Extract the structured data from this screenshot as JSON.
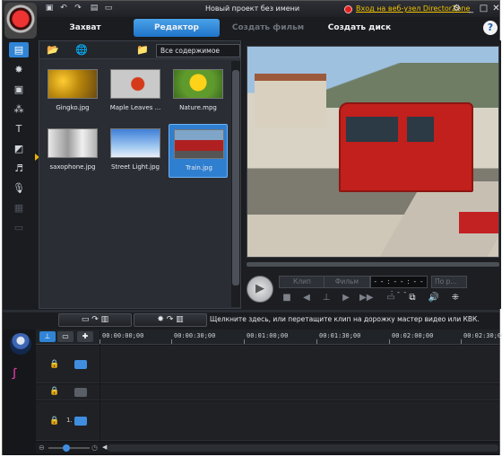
{
  "titlebar": {
    "title": "Новый проект без имени",
    "directorzone_link": "Вход на веб-узел DirectorZone",
    "quick_access": [
      "save-icon",
      "undo-icon",
      "redo-icon",
      "new-icon",
      "open-icon"
    ],
    "window_controls": [
      "settings-icon",
      "minimize-icon",
      "maximize-icon",
      "close-icon"
    ]
  },
  "tabs": [
    {
      "label": "Захват",
      "state": "normal"
    },
    {
      "label": "Редактор",
      "state": "active"
    },
    {
      "label": "Создать фильм",
      "state": "disabled"
    },
    {
      "label": "Создать диск",
      "state": "normal"
    }
  ],
  "help_label": "?",
  "sidebar": {
    "items": [
      "media-room-icon",
      "fx-room-icon",
      "pip-objects-icon",
      "particle-room-icon",
      "title-room-icon",
      "transition-room-icon",
      "audio-mixing-icon",
      "voice-over-icon",
      "chapter-room-icon",
      "subtitle-room-icon"
    ]
  },
  "library": {
    "filter_value": "Все содержимое",
    "items": [
      {
        "caption": "Gingko.jpg",
        "type": "ginkgo",
        "selected": false
      },
      {
        "caption": "Maple Leaves ...",
        "type": "maple",
        "selected": false
      },
      {
        "caption": "Nature.mpg",
        "type": "nature",
        "selected": false
      },
      {
        "caption": "saxophone.jpg",
        "type": "sax",
        "selected": false
      },
      {
        "caption": "Street Light.jpg",
        "type": "light",
        "selected": false
      },
      {
        "caption": "Train.jpg",
        "type": "train",
        "selected": true
      }
    ]
  },
  "preview": {
    "clip_label": "Клип",
    "movie_label": "Фильм",
    "timecode": "- - : - - : - - : - -",
    "quality": "По р..."
  },
  "timeline_toolbar": {
    "hint": "Щелкните здесь, или перетащите клип на дорожку мастер видео или КВК."
  },
  "ruler": {
    "ticks": [
      "00:00:00;00",
      "00:00:30;00",
      "00:01:00;00",
      "00:01:30;00",
      "00:02:00;00",
      "00:02:30;00"
    ]
  },
  "tracks": [
    "video-track",
    "effect-track",
    "pip-track"
  ],
  "track_number": "1."
}
